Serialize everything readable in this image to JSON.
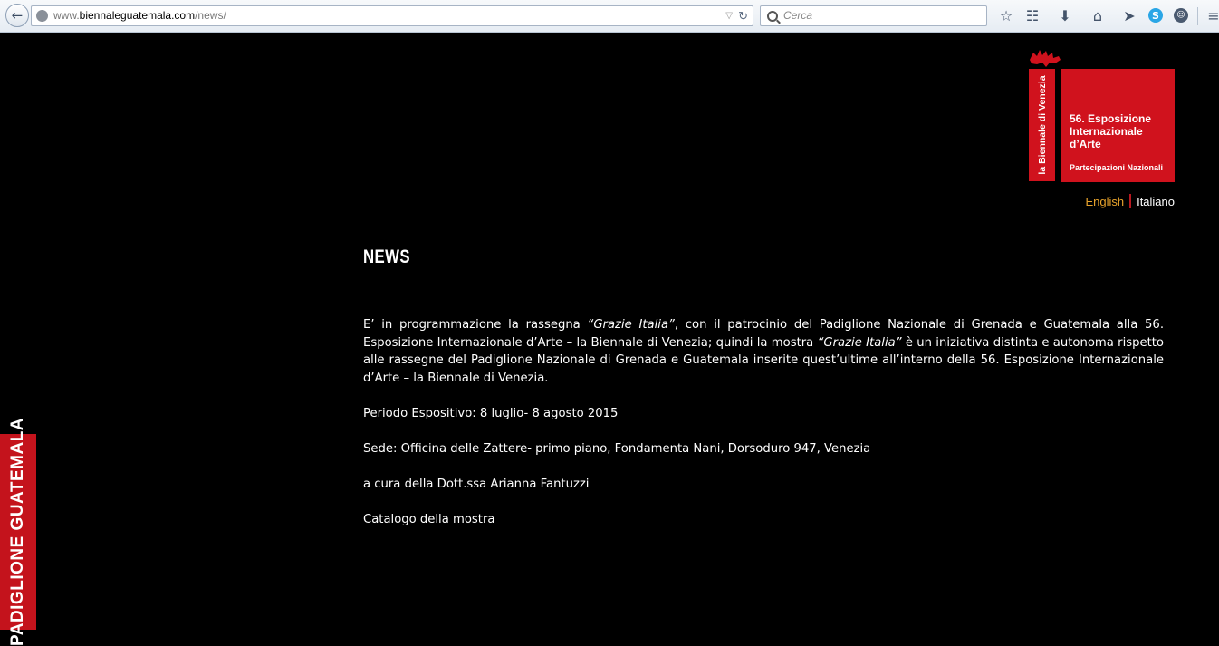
{
  "browser": {
    "url_prefix": "www.",
    "url_host": "biennaleguatemala.com",
    "url_path": "/news/",
    "search_placeholder": "Cerca"
  },
  "logo": {
    "strip_text": "la Biennale di Venezia",
    "line1": "56. Esposizione",
    "line2": "Internazionale",
    "line3": "d’Arte",
    "subtitle": "Partecipazioni Nazionali"
  },
  "lang": {
    "english": "English",
    "italian": "Italiano"
  },
  "page": {
    "title": "NEWS",
    "intro_a": "E’ in programmazione la rassegna ",
    "intro_b": "“Grazie Italia”",
    "intro_c": ", con il patrocinio del Padiglione Nazionale di Grenada e Guatemala alla 56. Esposizione Internazionale d’Arte – la Biennale di Venezia; quindi la mostra ",
    "intro_d": "“Grazie Italia”",
    "intro_e": " è un iniziativa distinta e autonoma rispetto alle rassegne del Padiglione Nazionale di Grenada e Guatemala inserite quest’ultime all’interno della 56. Esposizione Internazionale d’Arte – la Biennale di Venezia.",
    "periodo": "Periodo Espositivo: 8 luglio- 8 agosto 2015",
    "sede": "Sede: Officina delle Zattere- primo piano, Fondamenta Nani, Dorsoduro 947, Venezia",
    "curatela": "a cura della Dott.ssa Arianna Fantuzzi",
    "catalogo": "Catalogo della mostra"
  },
  "side_tab": "PADIGLIONE GUATEMALA",
  "colors": {
    "brand_red": "#d0121d",
    "english_link": "#e8a32c",
    "background": "#000000"
  }
}
